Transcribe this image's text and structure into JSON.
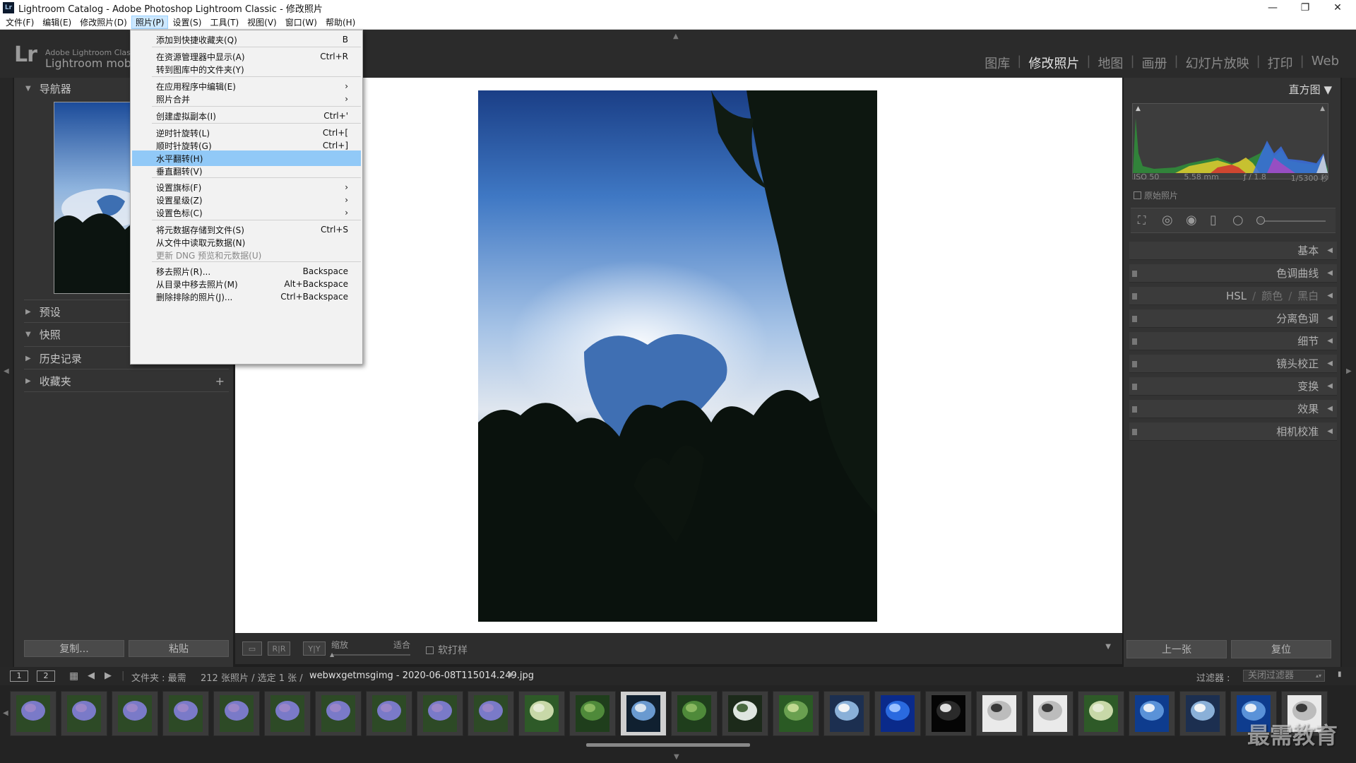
{
  "window": {
    "title": "Lightroom Catalog - Adobe Photoshop Lightroom Classic - 修改照片",
    "app_icon": "Lr",
    "controls": {
      "minimize": "—",
      "maximize": "❐",
      "close": "✕"
    }
  },
  "menubar": {
    "items": [
      "文件(F)",
      "编辑(E)",
      "修改照片(D)",
      "照片(P)",
      "设置(S)",
      "工具(T)",
      "视图(V)",
      "窗口(W)",
      "帮助(H)"
    ],
    "active": "照片(P)"
  },
  "brand": {
    "logo": "Lr",
    "line1": "Adobe Lightroom Classic",
    "line2": "Lightroom mobi"
  },
  "modules": {
    "items": [
      "图库",
      "修改照片",
      "地图",
      "画册",
      "幻灯片放映",
      "打印",
      "Web"
    ],
    "active": "修改照片"
  },
  "photo_menu": {
    "items": [
      {
        "label": "添加到快捷收藏夹(Q)",
        "shortcut": "B"
      },
      {
        "label": "在资源管理器中显示(A)",
        "shortcut": "Ctrl+R"
      },
      {
        "label": "转到图库中的文件夹(Y)",
        "shortcut": ""
      },
      {
        "label": "在应用程序中编辑(E)",
        "shortcut": "›"
      },
      {
        "label": "照片合并",
        "shortcut": "›"
      },
      {
        "label": "创建虚拟副本(I)",
        "shortcut": "Ctrl+'"
      },
      {
        "label": "逆时针旋转(L)",
        "shortcut": "Ctrl+["
      },
      {
        "label": "顺时针旋转(G)",
        "shortcut": "Ctrl+]"
      },
      {
        "label": "水平翻转(H)",
        "shortcut": ""
      },
      {
        "label": "垂直翻转(V)",
        "shortcut": ""
      },
      {
        "label": "设置旗标(F)",
        "shortcut": "›"
      },
      {
        "label": "设置星级(Z)",
        "shortcut": "›"
      },
      {
        "label": "设置色标(C)",
        "shortcut": "›"
      },
      {
        "label": "将元数据存储到文件(S)",
        "shortcut": "Ctrl+S"
      },
      {
        "label": "从文件中读取元数据(N)",
        "shortcut": ""
      },
      {
        "label": "更新 DNG 预览和元数据(U)",
        "shortcut": ""
      },
      {
        "label": "移去照片(R)...",
        "shortcut": "Backspace"
      },
      {
        "label": "从目录中移去照片(M)",
        "shortcut": "Alt+Backspace"
      },
      {
        "label": "删除排除的照片(J)...",
        "shortcut": "Ctrl+Backspace"
      }
    ],
    "highlighted": "水平翻转(H)",
    "disabled": "更新 DNG 预览和元数据(U)"
  },
  "left_panel": {
    "navigator": "导航器",
    "presets": "预设",
    "snapshots": "快照",
    "history": "历史记录",
    "collections": "收藏夹",
    "copy_button": "复制...",
    "paste_button": "粘贴"
  },
  "right_panel": {
    "histogram_title": "直方图",
    "exif": {
      "iso": "ISO 50",
      "focal": "5.58 mm",
      "aperture": "ƒ / 1.8",
      "shutter": "1/5300 秒"
    },
    "original_photo": "原始照片",
    "sections": [
      "基本",
      "色调曲线",
      "颜色",
      "分离色调",
      "细节",
      "镜头校正",
      "变换",
      "效果",
      "相机校准"
    ],
    "hsl_tabs": [
      "HSL",
      "颜色",
      "黑白"
    ],
    "prev_button": "上一张",
    "reset_button": "复位"
  },
  "toolbar": {
    "zoom_label": "缩放",
    "fit_label": "适合",
    "soft_proof": "软打样"
  },
  "filmstrip_bar": {
    "page1": "1",
    "page2": "2",
    "source": "文件夹 : 最需",
    "count": "212 张照片 / 选定 1 张 /",
    "filename": "webwxgetmsgimg - 2020-06-08T115014.249.jpg",
    "filter_label": "过滤器 :",
    "filter_value": "关闭过滤器"
  },
  "filmstrip": {
    "selected_index": 12,
    "thumbs": [
      "hydrangea",
      "hydrangea",
      "hydrangea",
      "hydrangea",
      "hydrangea",
      "hydrangea",
      "hydrangea",
      "hydrangea",
      "hydrangea",
      "hydrangea",
      "flowers",
      "green",
      "sky-trees",
      "green",
      "trees",
      "leaves",
      "clouds",
      "blue",
      "night",
      "tree",
      "tree",
      "flowers",
      "blue-sky",
      "clouds",
      "blue-sky",
      "tree",
      "sky"
    ]
  },
  "watermark": "最需教育",
  "colors": {
    "accent_highlight": "#91c9f7",
    "menu_active": "#cce8ff",
    "panel_bg": "#333333",
    "canvas_bg": "#ffffff"
  }
}
